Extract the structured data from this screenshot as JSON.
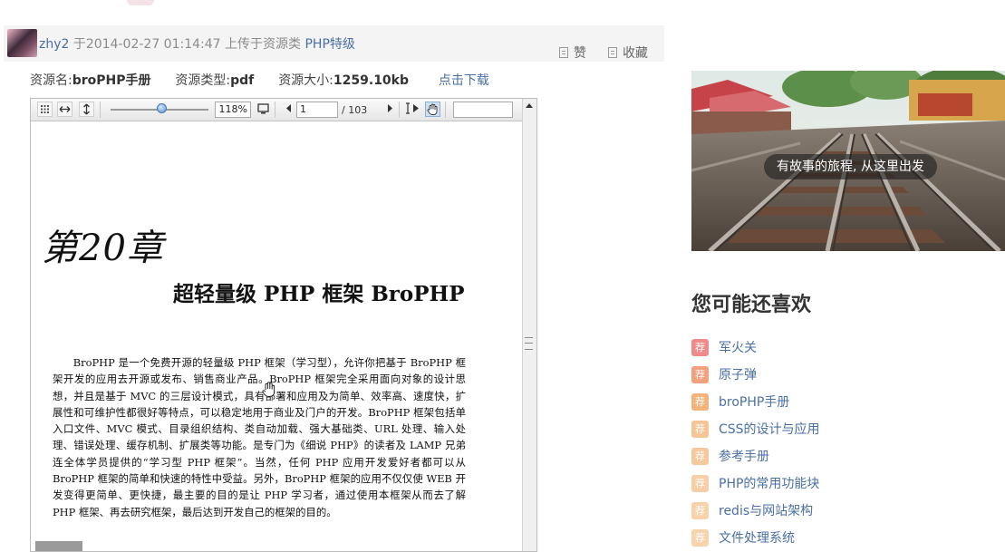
{
  "uploader": {
    "name": "zhy2",
    "text_mid": " 于2014-02-27 01:14:47 上传于资源类 ",
    "level": "PHP特级",
    "like_label": "赞",
    "fav_label": "收藏"
  },
  "info": {
    "name_label": "资源名:",
    "name_value": "broPHP手册",
    "type_label": "资源类型:",
    "type_value": "pdf",
    "size_label": "资源大小:",
    "size_value": "1259.10kb",
    "download_label": "点击下载"
  },
  "viewer": {
    "zoom": "118%",
    "current_page": "1",
    "total_pages": "/ 103",
    "search_value": ""
  },
  "page": {
    "chapter": "第20章",
    "title": "超轻量级 PHP 框架 BroPHP",
    "paragraph": "BroPHP 是一个免费开源的轻量级 PHP 框架（学习型），允许你把基于 BroPHP 框架开发的应用去开源或发布、销售商业产品。BroPHP 框架完全采用面向对象的设计思想，并且是基于 MVC 的三层设计模式，具有部署和应用及为简单、效率高、速度快，扩展性和可维护性都很好等特点，可以稳定地用于商业及门户的开发。BroPHP 框架包括单入口文件、MVC 模式、目录组织结构、类自动加载、强大基础类、URL 处理、输入处理、错误处理、缓存机制、扩展类等功能。是专门为《细说 PHP》的读者及 LAMP 兄弟连全体学员提供的“学习型 PHP 框架”。当然，任何 PHP 应用开发爱好者都可以从 BroPHP 框架的简单和快速的特性中受益。另外，BroPHP 框架的应用不仅仅使 WEB 开发变得更简单、更快捷，最主要的目的是让 PHP 学习者，通过使用本框架从而去了解 PHP 框架、再去研究框架，最后达到开发自己的框架的目的。"
  },
  "banner": {
    "caption": "有故事的旅程, 从这里出发"
  },
  "recommend": {
    "title": "您可能还喜欢",
    "tag": "荐",
    "items": [
      {
        "label": "军火关",
        "color": "#f08a8a"
      },
      {
        "label": "原子弹",
        "color": "#f3a07c"
      },
      {
        "label": "broPHP手册",
        "color": "#f4b37a"
      },
      {
        "label": "CSS的设计与应用",
        "color": "#f6c595"
      },
      {
        "label": "参考手册",
        "color": "#f6c99c"
      },
      {
        "label": "PHP的常用功能块",
        "color": "#f7cea5"
      },
      {
        "label": "redis与网站架构",
        "color": "#f7d2aa"
      },
      {
        "label": "文件处理系统",
        "color": "#f8d4ad"
      }
    ]
  }
}
